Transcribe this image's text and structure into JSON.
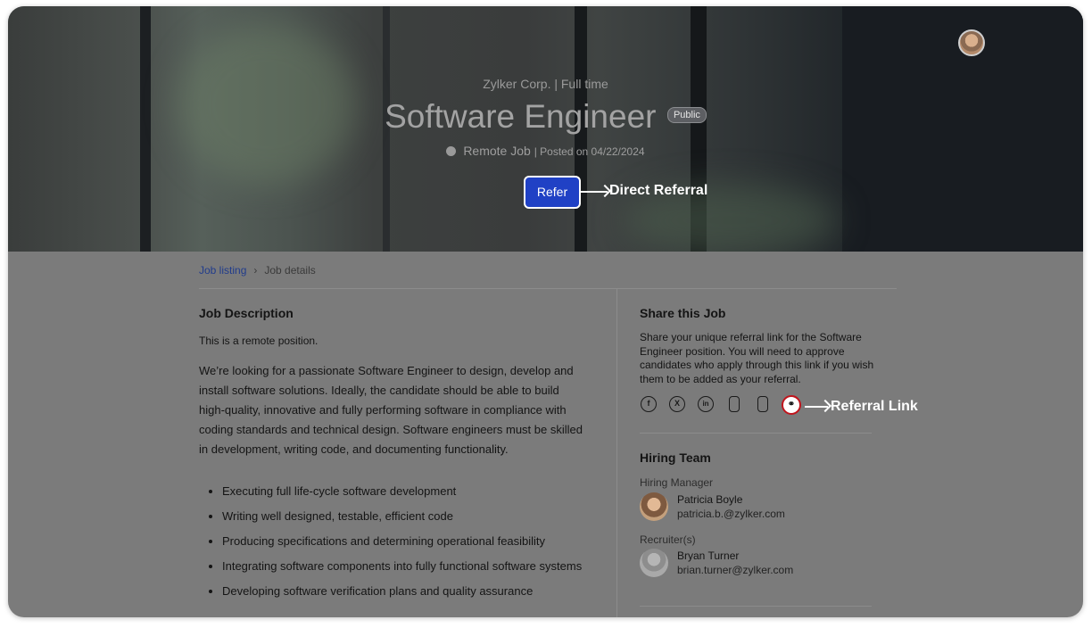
{
  "header": {
    "company_line": "Zylker Corp. | Full time",
    "title": "Software Engineer",
    "badge": "Public",
    "location": "Remote Job",
    "posted": "| Posted on 04/22/2024",
    "refer_label": "Refer",
    "annotation_refer": "Direct Referral"
  },
  "breadcrumb": {
    "parent": "Job listing",
    "current": "Job details"
  },
  "description": {
    "heading": "Job Description",
    "intro": "This is a remote position.",
    "body": "We’re looking for a passionate Software Engineer to design, develop and install software solutions. Ideally, the candidate should be able to build high-quality, innovative and fully performing software in compliance with coding standards and technical design. Software engineers must be skilled in development, writing code, and documenting functionality.",
    "bullets": [
      "Executing full life-cycle software development",
      "Writing well designed, testable, efficient code",
      "Producing specifications and determining operational feasibility",
      "Integrating software components into fully functional software systems",
      "Developing  software verification plans and quality assurance"
    ]
  },
  "share": {
    "heading": "Share this Job",
    "text": "Share your unique referral link for the Software Engineer position. You will need to approve candidates who apply through this link if you wish them to be added as your referral.",
    "icons": [
      "facebook-icon",
      "x-icon",
      "linkedin-icon",
      "share-icon",
      "mobile-icon",
      "link-icon"
    ],
    "annotation_link": "Referral Link"
  },
  "hiring_team": {
    "heading": "Hiring Team",
    "manager_label": "Hiring Manager",
    "manager_name": "Patricia Boyle",
    "manager_email": "patricia.b.@zylker.com",
    "recruiter_label": "Recruiter(s)",
    "recruiter_name": "Bryan Turner",
    "recruiter_email": "brian.turner@zylker.com"
  }
}
